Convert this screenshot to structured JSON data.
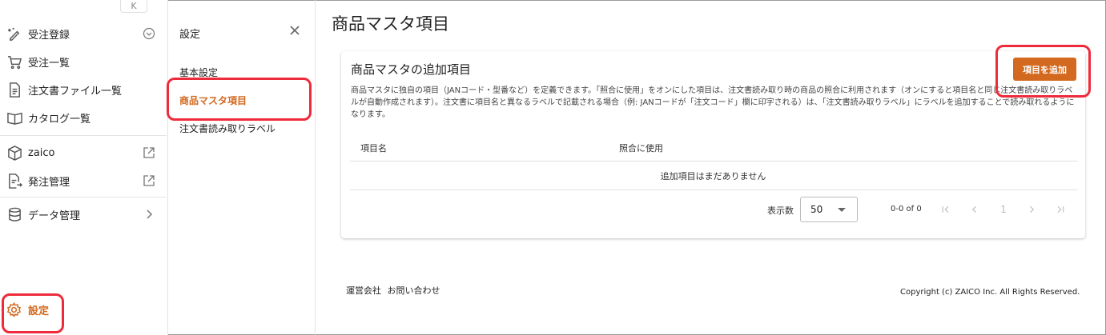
{
  "sidebar": {
    "collapse_label": "K",
    "items": [
      {
        "label": "受注登録",
        "icon": "pencil-sparkle-icon"
      },
      {
        "label": "受注一覧",
        "icon": "cart-icon"
      },
      {
        "label": "注文書ファイル一覧",
        "icon": "document-icon"
      },
      {
        "label": "カタログ一覧",
        "icon": "open-book-icon"
      },
      {
        "label": "zaico",
        "icon": "box-icon"
      },
      {
        "label": "発注管理",
        "icon": "document-export-icon"
      },
      {
        "label": "データ管理",
        "icon": "database-icon"
      }
    ],
    "settings_label": "設定"
  },
  "subpanel": {
    "title": "設定",
    "items": [
      "基本設定",
      "商品マスタ項目",
      "注文書読み取りラベル"
    ]
  },
  "main": {
    "page_title": "商品マスタ項目",
    "card_title": "商品マスタの追加項目",
    "add_button": "項目を追加",
    "description": "商品マスタに独自の項目（JANコード・型番など）を定義できます。「照合に使用」をオンにした項目は、注文書読み取り時の商品の照合に利用されます（オンにすると項目名と同じ注文書読み取りラベルが自動作成されます）。注文書に項目名と異なるラベルで記載される場合（例: JANコードが「注文コード」欄に印字される）は、「注文書読み取りラベル」にラベルを追加することで読み取れるようになります。",
    "table": {
      "columns": [
        "項目名",
        "照合に使用"
      ],
      "empty_text": "追加項目はまだありません"
    },
    "pagination": {
      "rows_label": "表示数",
      "rows_value": "50",
      "range": "0-0 of 0",
      "page": "1"
    }
  },
  "footer": {
    "links": [
      "運営会社",
      "お問い合わせ"
    ],
    "copyright": "Copyright (c) ZAICO Inc. All Rights Reserved."
  },
  "colors": {
    "accent": "#d2691e",
    "highlight": "#ee2b3b"
  }
}
